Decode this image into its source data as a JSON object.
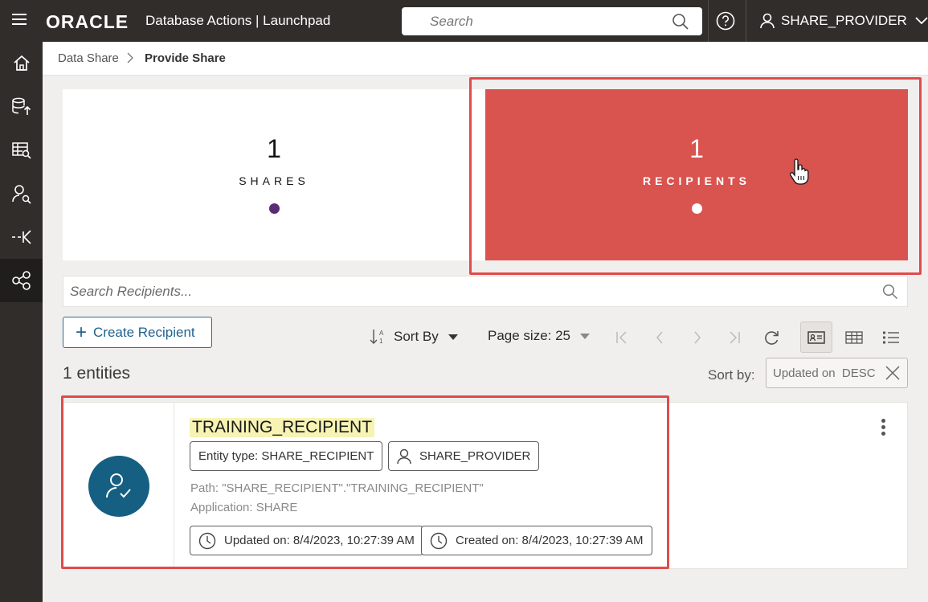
{
  "header": {
    "brand": "ORACLE",
    "app_title": "Database Actions |  Launchpad",
    "search_placeholder": "Search",
    "user": "SHARE_PROVIDER"
  },
  "nav": {
    "items": [
      "home-icon",
      "data-load-icon",
      "catalog-icon",
      "user-search-icon",
      "transform-icon",
      "data-share-icon"
    ],
    "active_index": 5
  },
  "breadcrumb": {
    "parent": "Data Share",
    "current": "Provide Share"
  },
  "tiles": {
    "shares": {
      "count": "1",
      "label": "SHARES"
    },
    "recipients": {
      "count": "1",
      "label": "RECIPIENTS"
    }
  },
  "recipients": {
    "search_placeholder": "Search Recipients...",
    "create_label": "Create Recipient",
    "sort_by_label": "Sort By",
    "page_size_label": "Page size: 25",
    "entity_count": "1 entities",
    "sort_by_caption": "Sort by:",
    "sort_chip": "Updated on  DESC"
  },
  "card": {
    "title": "TRAINING_RECIPIENT",
    "entity_type": "Entity type: SHARE_RECIPIENT",
    "owner": "SHARE_PROVIDER",
    "path": "Path: \"SHARE_RECIPIENT\".\"TRAINING_RECIPIENT\"",
    "application": "Application: SHARE",
    "updated": "Updated on: 8/4/2023, 10:27:39 AM",
    "created": "Created on: 8/4/2023, 10:27:39 AM"
  },
  "colors": {
    "header_bg": "#312d2a",
    "recipients_tile": "#d9534f",
    "shares_dot": "#5b2b74",
    "accent_blue": "#155f82",
    "highlight": "#e04b4b"
  }
}
